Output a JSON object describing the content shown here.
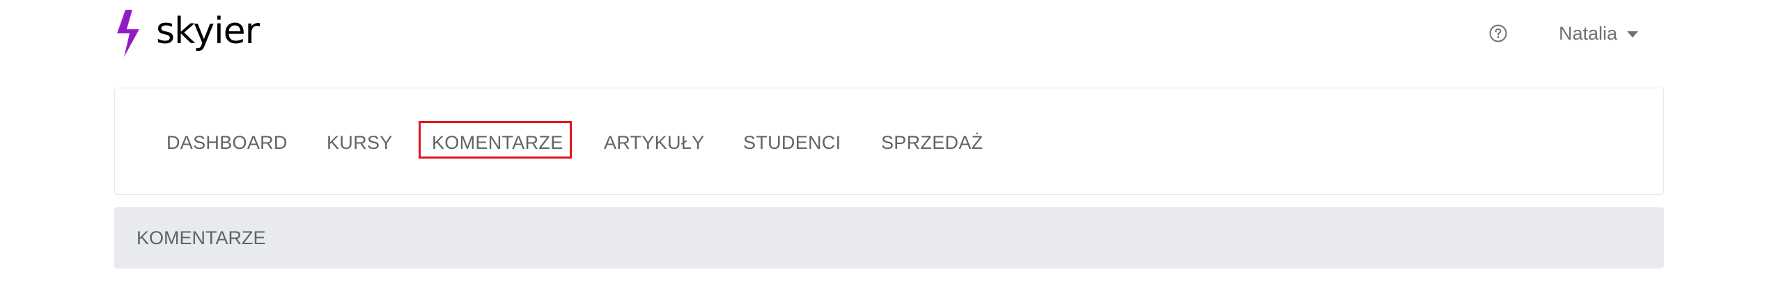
{
  "brand": {
    "name": "skyier",
    "accent_color": "#9b1fc6"
  },
  "header": {
    "help_icon": "question-circle-icon",
    "user_name": "Natalia",
    "user_caret_icon": "caret-down-icon"
  },
  "nav": {
    "items": [
      {
        "label": "DASHBOARD"
      },
      {
        "label": "KURSY"
      },
      {
        "label": "KOMENTARZE",
        "active": true
      },
      {
        "label": "ARTYKUŁY"
      },
      {
        "label": "STUDENCI"
      },
      {
        "label": "SPRZEDAŻ"
      }
    ],
    "highlight_color": "#e0141d"
  },
  "section": {
    "title": "KOMENTARZE"
  }
}
